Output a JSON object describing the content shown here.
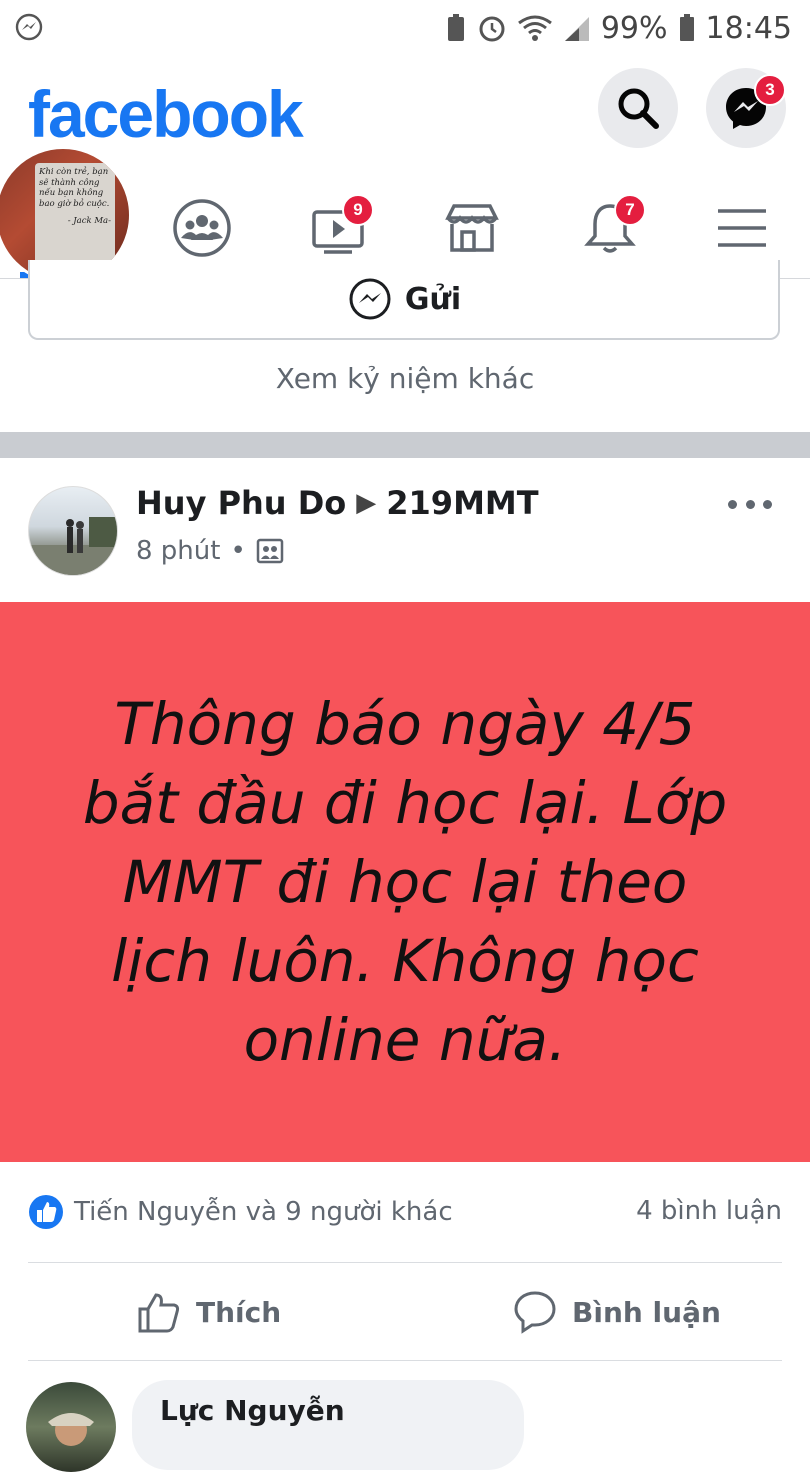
{
  "status_bar": {
    "battery_percent": "99%",
    "time": "18:45"
  },
  "header": {
    "logo_text": "facebook",
    "messenger_badge": "3"
  },
  "tabs": {
    "watch_badge": "9",
    "notifications_badge": "7"
  },
  "profile": {
    "quote_text": "Khi còn trẻ, bạn sẽ thành công nếu bạn không bao giờ bỏ cuộc.",
    "quote_author": "- Jack Ma-"
  },
  "memory": {
    "send_label": "Gửi",
    "more_memories": "Xem kỷ niệm khác"
  },
  "post": {
    "author": "Huy Phu Do",
    "group": "219MMT",
    "time": "8 phút",
    "text": "Thông báo ngày 4/5 bắt đầu đi học lại. Lớp MMT đi học lại theo lịch luôn. Không học online nữa.",
    "background_color": "#f7545a",
    "reactions_text": "Tiến Nguyễn và 9 người khác",
    "comments_count": "4 bình luận",
    "like_label": "Thích",
    "comment_label": "Bình luận"
  },
  "comment_preview": {
    "name": "Lực Nguyễn"
  },
  "colors": {
    "brand": "#1877f2",
    "badge": "#e41e3f"
  }
}
